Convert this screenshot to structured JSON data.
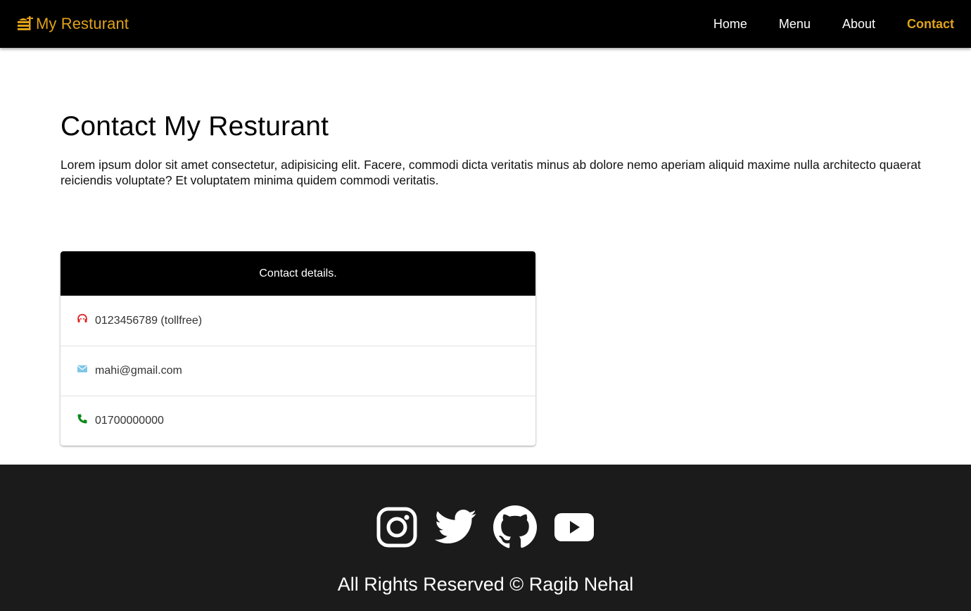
{
  "brand": {
    "name": "My Resturant",
    "color": "#e0a21a"
  },
  "nav": {
    "items": [
      {
        "label": "Home",
        "active": false
      },
      {
        "label": "Menu",
        "active": false
      },
      {
        "label": "About",
        "active": false
      },
      {
        "label": "Contact",
        "active": true
      }
    ]
  },
  "page": {
    "title": "Contact My Resturant",
    "intro": "Lorem ipsum dolor sit amet consectetur, adipisicing elit. Facere, commodi dicta veritatis minus ab dolore nemo aperiam aliquid maxime nulla architecto quaerat reiciendis voluptate? Et voluptatem minima quidem commodi veritatis."
  },
  "contact_card": {
    "header": "Contact details.",
    "rows": [
      {
        "icon": "headset-icon",
        "color": "#e02020",
        "text": "0123456789 (tollfree)"
      },
      {
        "icon": "mail-icon",
        "color": "#7fc6e8",
        "text": "mahi@gmail.com"
      },
      {
        "icon": "phone-icon",
        "color": "#0a8a18",
        "text": "01700000000"
      }
    ]
  },
  "footer": {
    "socials": [
      "instagram-icon",
      "twitter-icon",
      "github-icon",
      "youtube-icon"
    ],
    "copyright": "All Rights Reserved © Ragib Nehal"
  }
}
